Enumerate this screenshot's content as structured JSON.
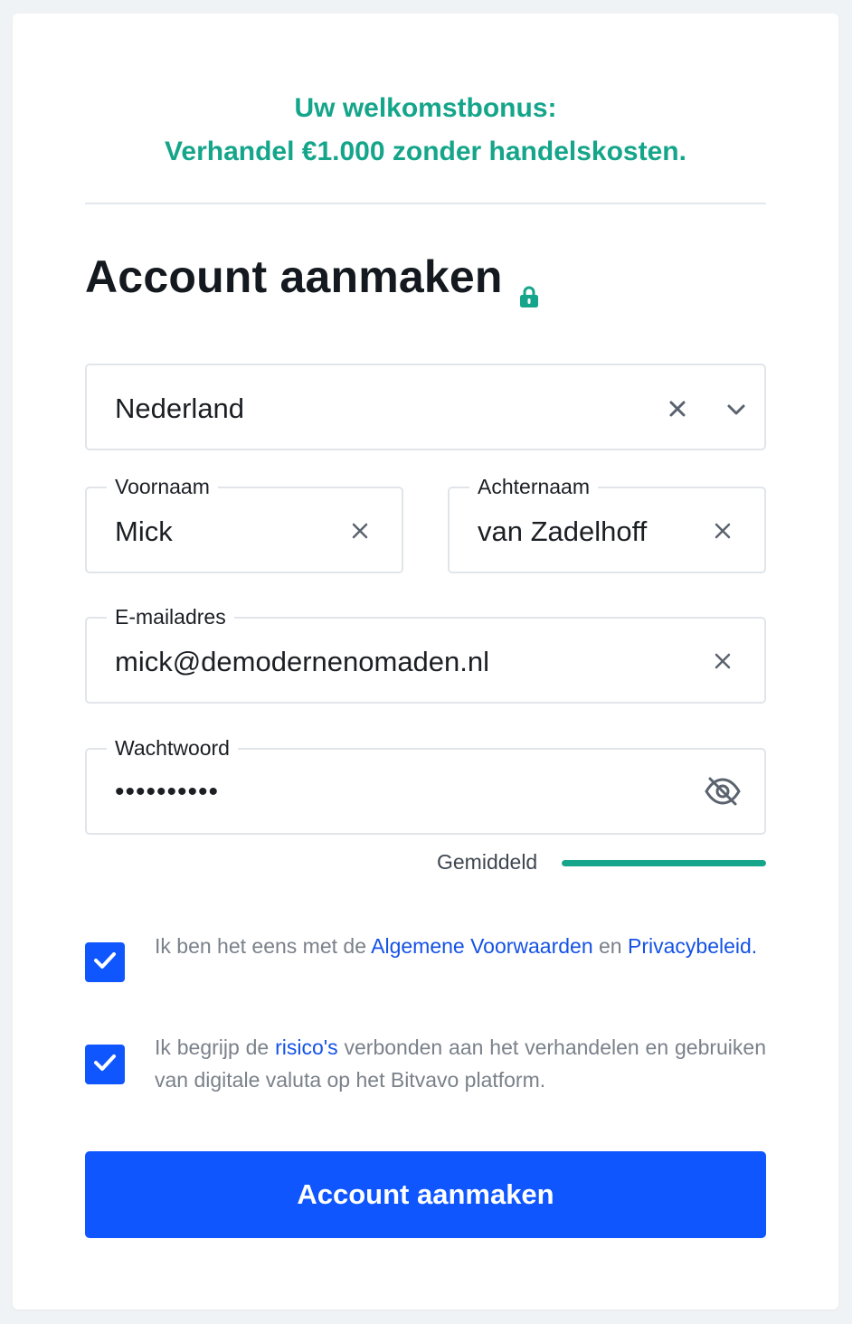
{
  "promo": {
    "line1": "Uw welkomstbonus:",
    "line2": "Verhandel €1.000 zonder handelskosten."
  },
  "form": {
    "title": "Account aanmaken",
    "country": {
      "value": "Nederland"
    },
    "first_name": {
      "label": "Voornaam",
      "value": "Mick"
    },
    "last_name": {
      "label": "Achternaam",
      "value": "van Zadelhoff"
    },
    "email": {
      "label": "E-mailadres",
      "value": "mick@demodernenomaden.nl"
    },
    "password": {
      "label": "Wachtwoord",
      "masked_value": "••••••••••"
    },
    "strength": {
      "label": "Gemiddeld",
      "fraction": 1.0
    },
    "terms": {
      "text_before": "Ik ben het eens met de",
      "link1": "Algemene Voorwaarden",
      "text_middle": "en",
      "link2": "Privacybeleid.",
      "checked": true
    },
    "risk": {
      "text_before": "Ik begrijp de",
      "link": "risico's",
      "text_after": "verbonden aan het verhandelen en gebruiken van digitale valuta op het Bitvavo platform.",
      "checked": true
    },
    "submit_label": "Account aanmaken"
  },
  "colors": {
    "accent_green": "#14a58a",
    "primary_blue": "#0f56ff",
    "link_blue": "#1452e6"
  },
  "icons": {
    "title": "lock-icon",
    "clear": "close-icon",
    "dropdown": "chevron-down-icon",
    "password_toggle": "eye-off-icon",
    "checkbox": "checkmark-icon"
  }
}
